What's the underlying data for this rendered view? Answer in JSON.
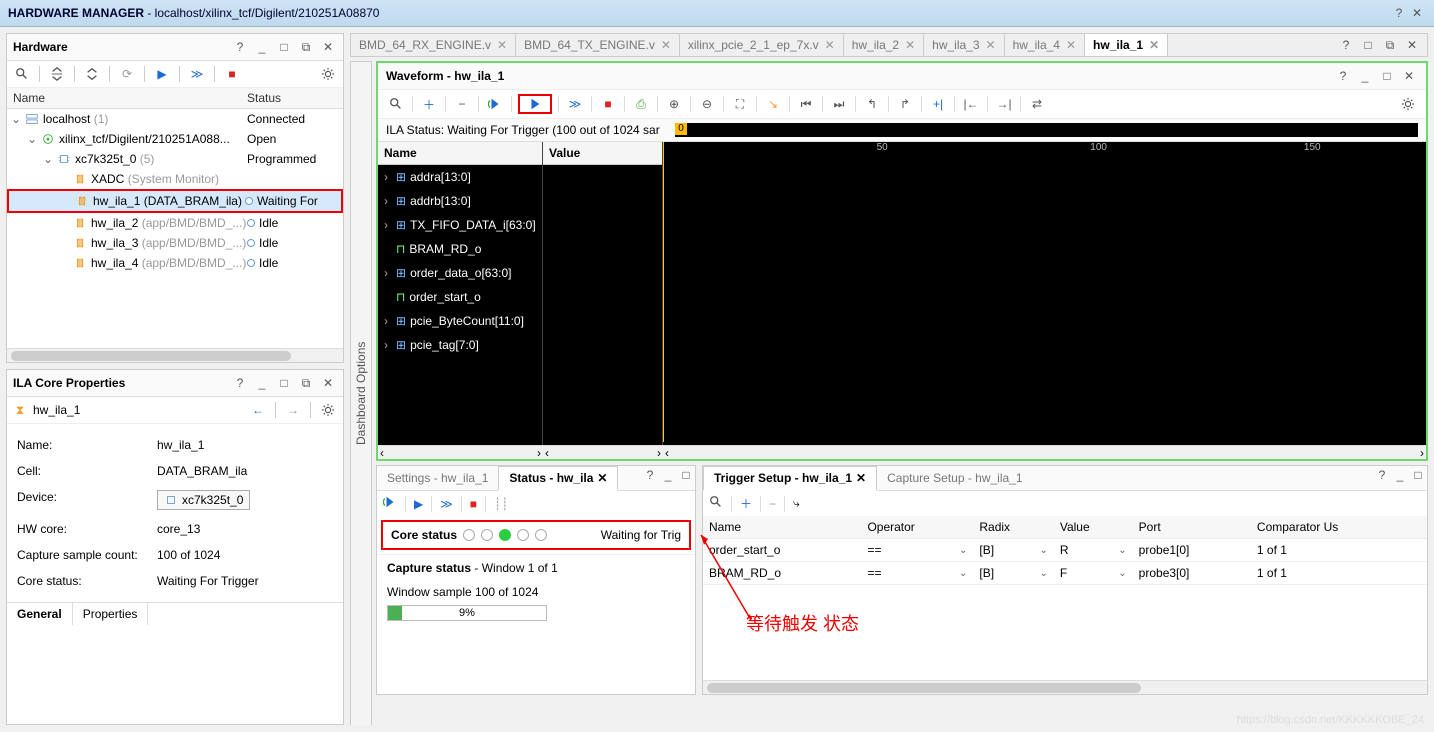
{
  "titlebar": {
    "app": "HARDWARE MANAGER",
    "path": "localhost/xilinx_tcf/Digilent/210251A08870"
  },
  "hardware": {
    "title": "Hardware",
    "cols": {
      "name": "Name",
      "status": "Status"
    },
    "rows": [
      {
        "indent": 0,
        "caret": "v",
        "icon": "server",
        "label": "localhost",
        "extra": "(1)",
        "status": "Connected"
      },
      {
        "indent": 1,
        "caret": "v",
        "icon": "target",
        "label": "xilinx_tcf/Digilent/210251A088...",
        "status": "Open"
      },
      {
        "indent": 2,
        "caret": "v",
        "icon": "chip",
        "label": "xc7k325t_0",
        "extra": "(5)",
        "status": "Programmed"
      },
      {
        "indent": 3,
        "caret": "",
        "icon": "xadc",
        "label": "XADC",
        "extra": "(System Monitor)",
        "status": ""
      },
      {
        "indent": 3,
        "caret": "",
        "icon": "ila",
        "label": "hw_ila_1 (DATA_BRAM_ila)",
        "status": "Waiting For",
        "dot": true,
        "selected": true,
        "redbox": true
      },
      {
        "indent": 3,
        "caret": "",
        "icon": "ila",
        "label": "hw_ila_2",
        "extra": "(app/BMD/BMD_...)",
        "status": "Idle",
        "dot": true
      },
      {
        "indent": 3,
        "caret": "",
        "icon": "ila",
        "label": "hw_ila_3",
        "extra": "(app/BMD/BMD_...)",
        "status": "Idle",
        "dot": true
      },
      {
        "indent": 3,
        "caret": "",
        "icon": "ila",
        "label": "hw_ila_4",
        "extra": "(app/BMD/BMD_...)",
        "status": "Idle",
        "dot": true
      }
    ]
  },
  "ilaprops": {
    "title": "ILA Core Properties",
    "name": "hw_ila_1",
    "props": [
      {
        "k": "Name:",
        "v": "hw_ila_1"
      },
      {
        "k": "Cell:",
        "v": "DATA_BRAM_ila"
      },
      {
        "k": "Device:",
        "v": "xc7k325t_0",
        "chip": true
      },
      {
        "k": "HW core:",
        "v": "core_13"
      },
      {
        "k": "Capture sample count:",
        "v": "100 of 1024"
      },
      {
        "k": "Core status:",
        "v": "Waiting For Trigger"
      }
    ],
    "tabs": [
      "General",
      "Properties"
    ]
  },
  "toptabs": [
    {
      "label": "BMD_64_RX_ENGINE.v"
    },
    {
      "label": "BMD_64_TX_ENGINE.v"
    },
    {
      "label": "xilinx_pcie_2_1_ep_7x.v"
    },
    {
      "label": "hw_ila_2"
    },
    {
      "label": "hw_ila_3"
    },
    {
      "label": "hw_ila_4"
    },
    {
      "label": "hw_ila_1",
      "active": true
    }
  ],
  "dashboard": "Dashboard Options",
  "waveform": {
    "title": "Waveform - hw_ila_1",
    "ila_status_label": "ILA Status:",
    "ila_status": "Waiting For Trigger (100 out of 1024 sar",
    "name_col": "Name",
    "value_col": "Value",
    "signals": [
      "addra[13:0]",
      "addrb[13:0]",
      "TX_FIFO_DATA_i[63:0]",
      "BRAM_RD_o",
      "order_data_o[63:0]",
      "order_start_o",
      "pcie_ByteCount[11:0]",
      "pcie_tag[7:0]"
    ],
    "ticks": [
      "50",
      "100",
      "150"
    ],
    "cursor0": "0"
  },
  "status_panel": {
    "tabs": [
      "Settings - hw_ila_1",
      "Status - hw_ila"
    ],
    "core_status_label": "Core status",
    "core_status_text": "Waiting for Trig",
    "capture_status_label": "Capture status",
    "capture_window": "Window 1 of 1",
    "sample_text": "Window sample 100 of 1024",
    "progress_pct": "9%"
  },
  "trigger_panel": {
    "tabs": [
      "Trigger Setup - hw_ila_1",
      "Capture Setup - hw_ila_1"
    ],
    "cols": [
      "Name",
      "Operator",
      "Radix",
      "Value",
      "Port",
      "Comparator Us"
    ],
    "rows": [
      {
        "name": "order_start_o",
        "op": "==",
        "radix": "[B]",
        "value": "R",
        "port": "probe1[0]",
        "comp": "1 of 1"
      },
      {
        "name": "BRAM_RD_o",
        "op": "==",
        "radix": "[B]",
        "value": "F",
        "port": "probe3[0]",
        "comp": "1 of 1"
      }
    ]
  },
  "annotation": "等待触发 状态",
  "watermark": "https://blog.csdn.net/KKKKKKOBE_24"
}
